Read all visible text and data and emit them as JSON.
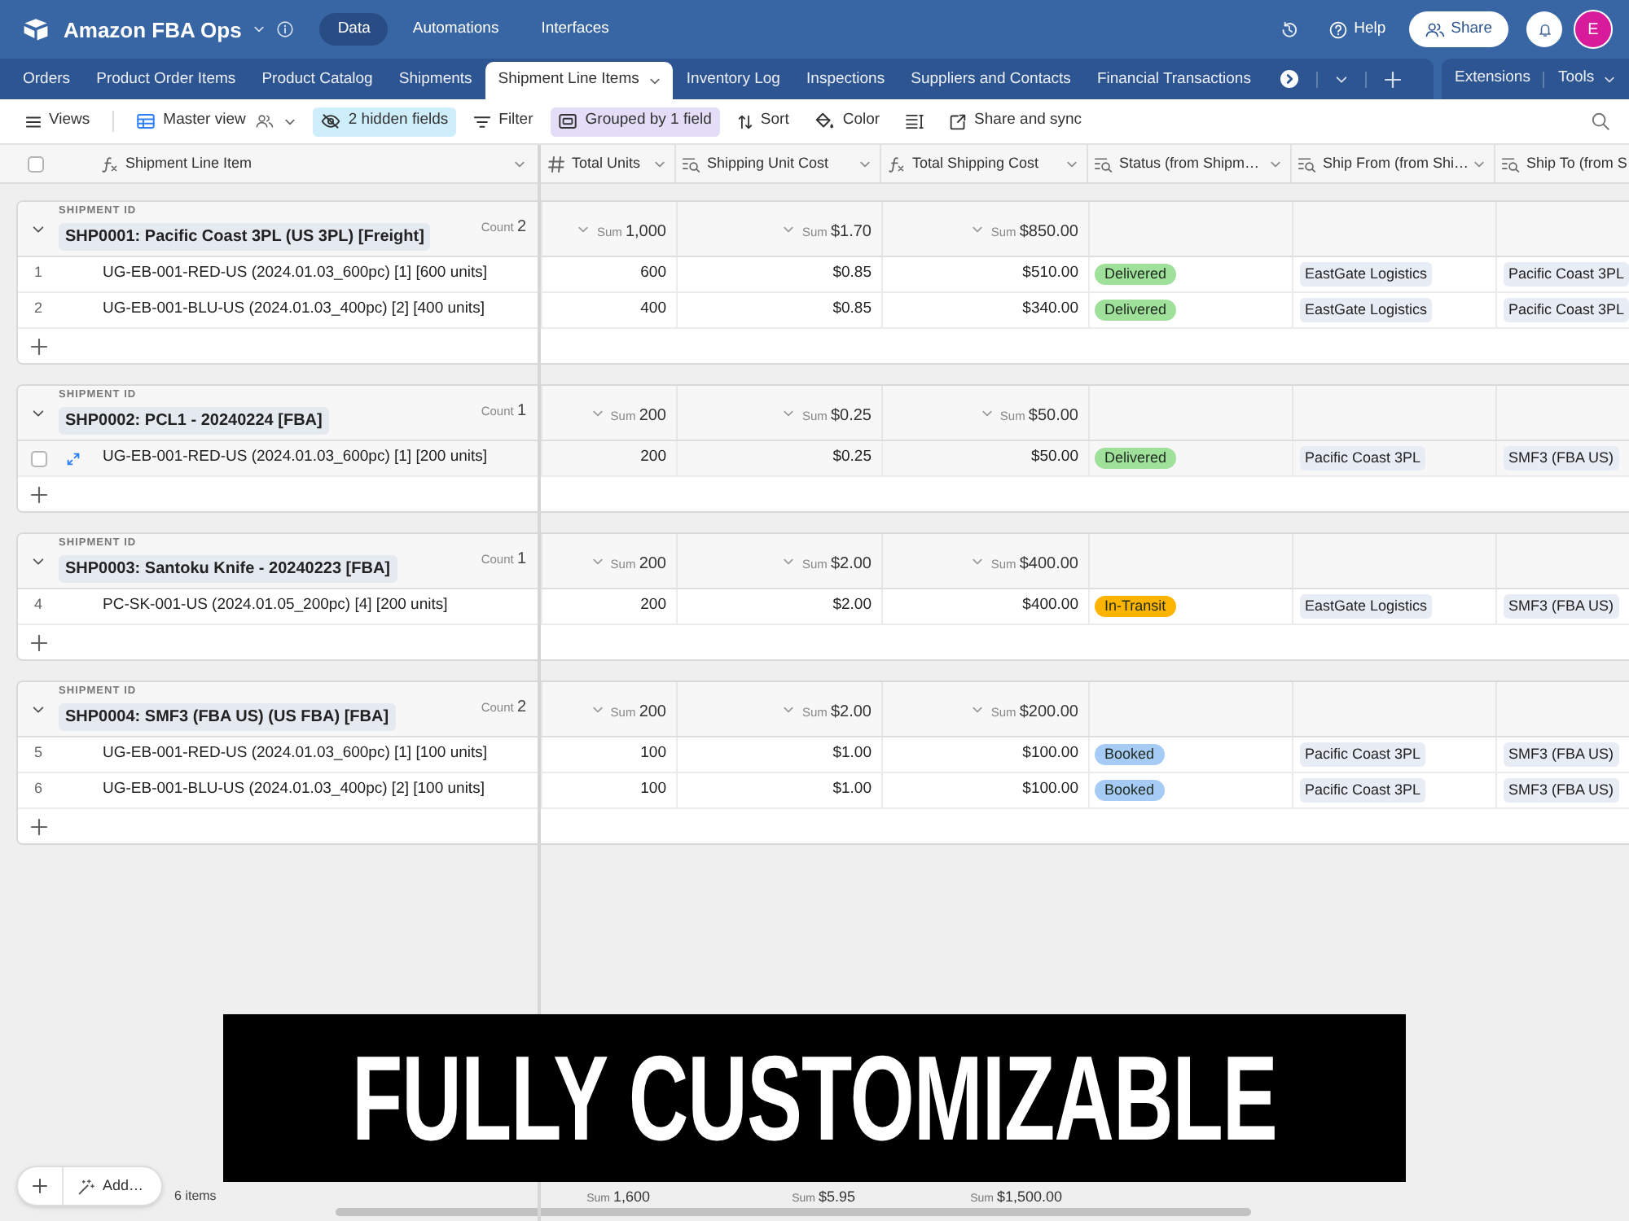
{
  "top_bar": {
    "app_name": "Amazon FBA Ops",
    "nav": [
      {
        "label": "Data",
        "selected": true
      },
      {
        "label": "Automations",
        "selected": false
      },
      {
        "label": "Interfaces",
        "selected": false
      }
    ],
    "help": "Help",
    "share": "Share",
    "avatar": "E"
  },
  "tabs": [
    {
      "label": "Orders",
      "selected": false
    },
    {
      "label": "Product Order Items",
      "selected": false
    },
    {
      "label": "Product Catalog",
      "selected": false
    },
    {
      "label": "Shipments",
      "selected": false
    },
    {
      "label": "Shipment Line Items",
      "selected": true
    },
    {
      "label": "Inventory Log",
      "selected": false
    },
    {
      "label": "Inspections",
      "selected": false
    },
    {
      "label": "Suppliers and Contacts",
      "selected": false
    },
    {
      "label": "Financial Transactions",
      "selected": false
    }
  ],
  "tab_actions": {
    "extensions": "Extensions",
    "tools": "Tools"
  },
  "toolbar": [
    {
      "kind": "views",
      "label": "Views",
      "active": false
    },
    {
      "kind": "view",
      "label": "Master view",
      "active": false
    },
    {
      "kind": "hide_fields",
      "label": "2 hidden fields",
      "active": true
    },
    {
      "kind": "filter",
      "label": "Filter",
      "active": false
    },
    {
      "kind": "group",
      "label": "Grouped by 1 field",
      "active": true
    },
    {
      "kind": "sort",
      "label": "Sort",
      "active": false
    },
    {
      "kind": "color",
      "label": "Color",
      "active": false
    },
    {
      "kind": "row_height",
      "active": false
    },
    {
      "kind": "share",
      "label": "Share and sync",
      "active": false
    }
  ],
  "select_all": {
    "checked": false
  },
  "columns": [
    {
      "kind": "formula",
      "label": "Shipment Line Item"
    },
    {
      "kind": "number",
      "label": "Total Units"
    },
    {
      "kind": "lookup",
      "label": "Shipping Unit Cost"
    },
    {
      "kind": "formula",
      "label": "Total Shipping Cost"
    },
    {
      "kind": "lookup",
      "label": "Status (from Shipm…"
    },
    {
      "kind": "lookup",
      "label": "Ship From (from Shi…"
    },
    {
      "kind": "lookup",
      "label": "Ship To (from S"
    }
  ],
  "groups": [
    {
      "field_label": "SHIPMENT ID",
      "title": "SHP0001: Pacific Coast 3PL (US 3PL) [Freight]",
      "expanded": true,
      "count_label": "Count",
      "count": "2",
      "sums": [
        {
          "label": "Sum",
          "value": "1,000"
        },
        {
          "label": "Sum",
          "value": "$1.70"
        },
        {
          "label": "Sum",
          "value": "$850.00"
        }
      ],
      "rows": [
        {
          "hovered": false,
          "number": "1",
          "name": "UG-EB-001-RED-US (2024.01.03_600pc) [1] [600 units]",
          "total_units": "600",
          "shipping_unit_cost": "$0.85",
          "total_shipping_cost": "$510.00",
          "status": {
            "label": "Delivered",
            "color": "#9fe09b"
          },
          "ship_from": "EastGate Logistics",
          "ship_to": "Pacific Coast 3PL"
        },
        {
          "hovered": false,
          "number": "2",
          "name": "UG-EB-001-BLU-US (2024.01.03_400pc) [2] [400 units]",
          "total_units": "400",
          "shipping_unit_cost": "$0.85",
          "total_shipping_cost": "$340.00",
          "status": {
            "label": "Delivered",
            "color": "#9fe09b"
          },
          "ship_from": "EastGate Logistics",
          "ship_to": "Pacific Coast 3PL"
        }
      ]
    },
    {
      "field_label": "SHIPMENT ID",
      "title": "SHP0002: PCL1 - 20240224 [FBA]",
      "expanded": true,
      "count_label": "Count",
      "count": "1",
      "sums": [
        {
          "label": "Sum",
          "value": "200"
        },
        {
          "label": "Sum",
          "value": "$0.25"
        },
        {
          "label": "Sum",
          "value": "$50.00"
        }
      ],
      "rows": [
        {
          "hovered": true,
          "checked": false,
          "name": "UG-EB-001-RED-US (2024.01.03_600pc) [1] [200 units]",
          "total_units": "200",
          "shipping_unit_cost": "$0.25",
          "total_shipping_cost": "$50.00",
          "status": {
            "label": "Delivered",
            "color": "#9fe09b"
          },
          "ship_from": "Pacific Coast 3PL",
          "ship_to": "SMF3 (FBA US)"
        }
      ]
    },
    {
      "field_label": "SHIPMENT ID",
      "title": "SHP0003: Santoku Knife - 20240223 [FBA]",
      "expanded": true,
      "count_label": "Count",
      "count": "1",
      "sums": [
        {
          "label": "Sum",
          "value": "200"
        },
        {
          "label": "Sum",
          "value": "$2.00"
        },
        {
          "label": "Sum",
          "value": "$400.00"
        }
      ],
      "rows": [
        {
          "hovered": false,
          "number": "4",
          "name": "PC-SK-001-US (2024.01.05_200pc) [4] [200 units]",
          "total_units": "200",
          "shipping_unit_cost": "$2.00",
          "total_shipping_cost": "$400.00",
          "status": {
            "label": "In-Transit",
            "color": "#fcb400"
          },
          "ship_from": "EastGate Logistics",
          "ship_to": "SMF3 (FBA US)"
        }
      ]
    },
    {
      "field_label": "SHIPMENT ID",
      "title": "SHP0004: SMF3 (FBA US) (US FBA) [FBA]",
      "expanded": true,
      "count_label": "Count",
      "count": "2",
      "sums": [
        {
          "label": "Sum",
          "value": "200"
        },
        {
          "label": "Sum",
          "value": "$2.00"
        },
        {
          "label": "Sum",
          "value": "$200.00"
        }
      ],
      "rows": [
        {
          "hovered": false,
          "number": "5",
          "name": "UG-EB-001-RED-US (2024.01.03_600pc) [1] [100 units]",
          "total_units": "100",
          "shipping_unit_cost": "$1.00",
          "total_shipping_cost": "$100.00",
          "status": {
            "label": "Booked",
            "color": "#a6cbf5"
          },
          "ship_from": "Pacific Coast 3PL",
          "ship_to": "SMF3 (FBA US)"
        },
        {
          "hovered": false,
          "number": "6",
          "name": "UG-EB-001-BLU-US (2024.01.03_400pc) [2] [100 units]",
          "total_units": "100",
          "shipping_unit_cost": "$1.00",
          "total_shipping_cost": "$100.00",
          "status": {
            "label": "Booked",
            "color": "#a6cbf5"
          },
          "ship_from": "Pacific Coast 3PL",
          "ship_to": "SMF3 (FBA US)"
        }
      ]
    }
  ],
  "footer": {
    "add": "Add…",
    "item_count": "6 items",
    "sums": [
      {
        "label": "Sum",
        "value": "1,600"
      },
      {
        "label": "Sum",
        "value": "$5.95"
      },
      {
        "label": "Sum",
        "value": "$1,500.00"
      }
    ]
  },
  "promo_banner": "FULLY CUSTOMIZABLE"
}
